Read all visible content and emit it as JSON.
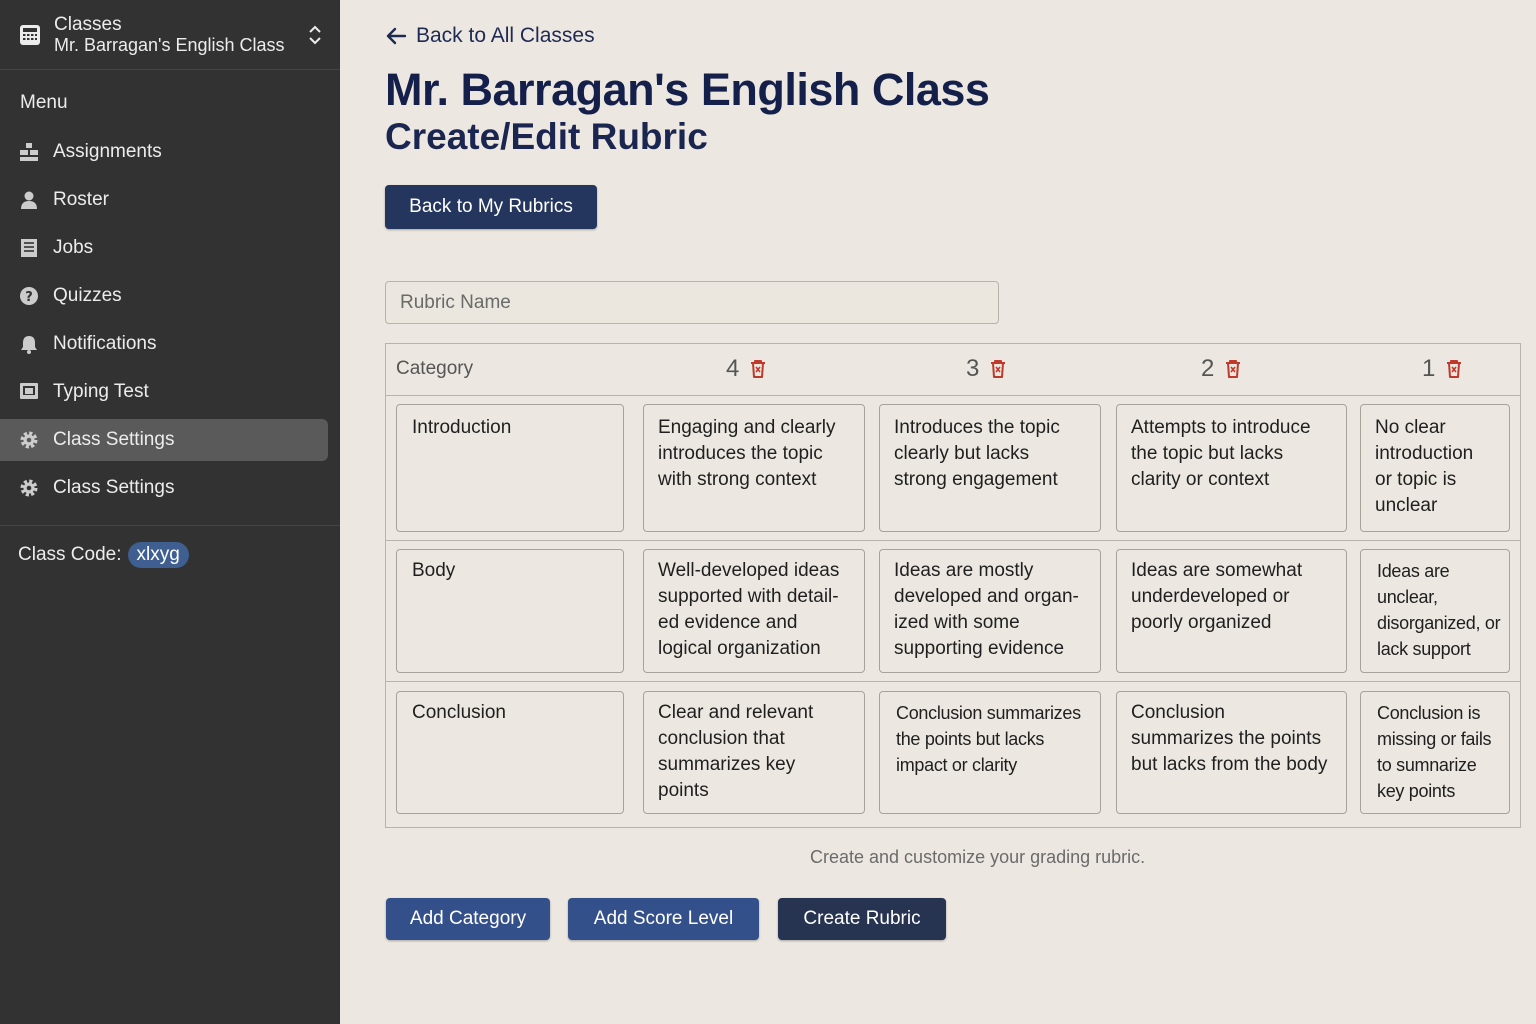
{
  "sidebar": {
    "switcher_label": "Classes",
    "switcher_class": "Mr. Barragan's English Class",
    "menu_label": "Menu",
    "items": [
      {
        "label": "Assignments",
        "icon": "assignments-icon"
      },
      {
        "label": "Roster",
        "icon": "person-icon"
      },
      {
        "label": "Jobs",
        "icon": "list-icon"
      },
      {
        "label": "Quizzes",
        "icon": "question-icon"
      },
      {
        "label": "Notifications",
        "icon": "bell-icon"
      },
      {
        "label": "Typing Test",
        "icon": "monitor-icon"
      },
      {
        "label": "Class Settings",
        "icon": "gear-icon",
        "active": true
      },
      {
        "label": "Class Settings",
        "icon": "gear-icon"
      }
    ],
    "class_code_label": "Class Code:",
    "class_code": "xlxyg"
  },
  "header": {
    "back_link": "Back to All Classes",
    "title": "Mr. Barragan's English Class",
    "subtitle": "Create/Edit Rubric",
    "back_rubrics_button": "Back to My Rubrics"
  },
  "form": {
    "rubric_name_placeholder": "Rubric Name",
    "rubric_name_value": ""
  },
  "rubric": {
    "category_header": "Category",
    "levels": [
      "4",
      "3",
      "2",
      "1"
    ],
    "rows": [
      {
        "category": "Introduction",
        "descriptors": [
          "Engaging and clearly introduces the topic with strong context",
          "Introduces the topic clearly but lacks strong engagement",
          "Attempts to introduce the topic but lacks clarity or context",
          "No clear introduction or topic is unclear"
        ]
      },
      {
        "category": "Body",
        "descriptors": [
          "Well-developed ideas supported with detail-ed evidence and logical organization",
          "Ideas are mostly developed and organ-ized with some supporting evidence",
          "Ideas are somewhat underdeveloped or poorly organized",
          "Ideas are unclear, disorganized, or lack support"
        ]
      },
      {
        "category": "Conclusion",
        "descriptors": [
          "Clear and relevant conclusion that summarizes key points",
          "Conclusion summarizes the points but lacks impact or clarity",
          "Conclusion summarizes the points but lacks from the body",
          "Conclusion is missing or fails to sumnarize key points"
        ]
      }
    ]
  },
  "footer": {
    "helper_text": "Create and customize your grading rubric.",
    "add_category": "Add Category",
    "add_score_level": "Add Score Level",
    "create_rubric": "Create Rubric"
  },
  "colors": {
    "sidebar_bg": "#323232",
    "page_bg": "#ece8e1",
    "primary_button": "#34508a",
    "dark_button": "#263452",
    "trash_icon": "#c0392b",
    "title_text": "#15204a"
  }
}
